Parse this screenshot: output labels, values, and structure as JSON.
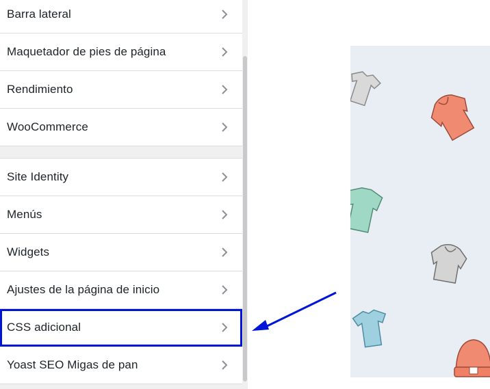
{
  "sidebar": {
    "group1": [
      {
        "label": "Barra lateral"
      },
      {
        "label": "Maquetador de pies de página"
      },
      {
        "label": "Rendimiento"
      },
      {
        "label": "WooCommerce"
      }
    ],
    "group2": [
      {
        "label": "Site Identity"
      },
      {
        "label": "Menús"
      },
      {
        "label": "Widgets"
      },
      {
        "label": "Ajustes de la página de inicio"
      },
      {
        "label": "CSS adicional"
      },
      {
        "label": "Yoast SEO Migas de pan"
      }
    ]
  },
  "colors": {
    "highlight": "#0015d6",
    "arrow": "#0015d6",
    "preview_bg": "#e8eef3"
  },
  "preview": {
    "items": [
      "tshirt-icon",
      "hoodie-icon",
      "shirt-icon",
      "hoodie-icon",
      "tshirt-icon",
      "beanie-icon"
    ]
  }
}
